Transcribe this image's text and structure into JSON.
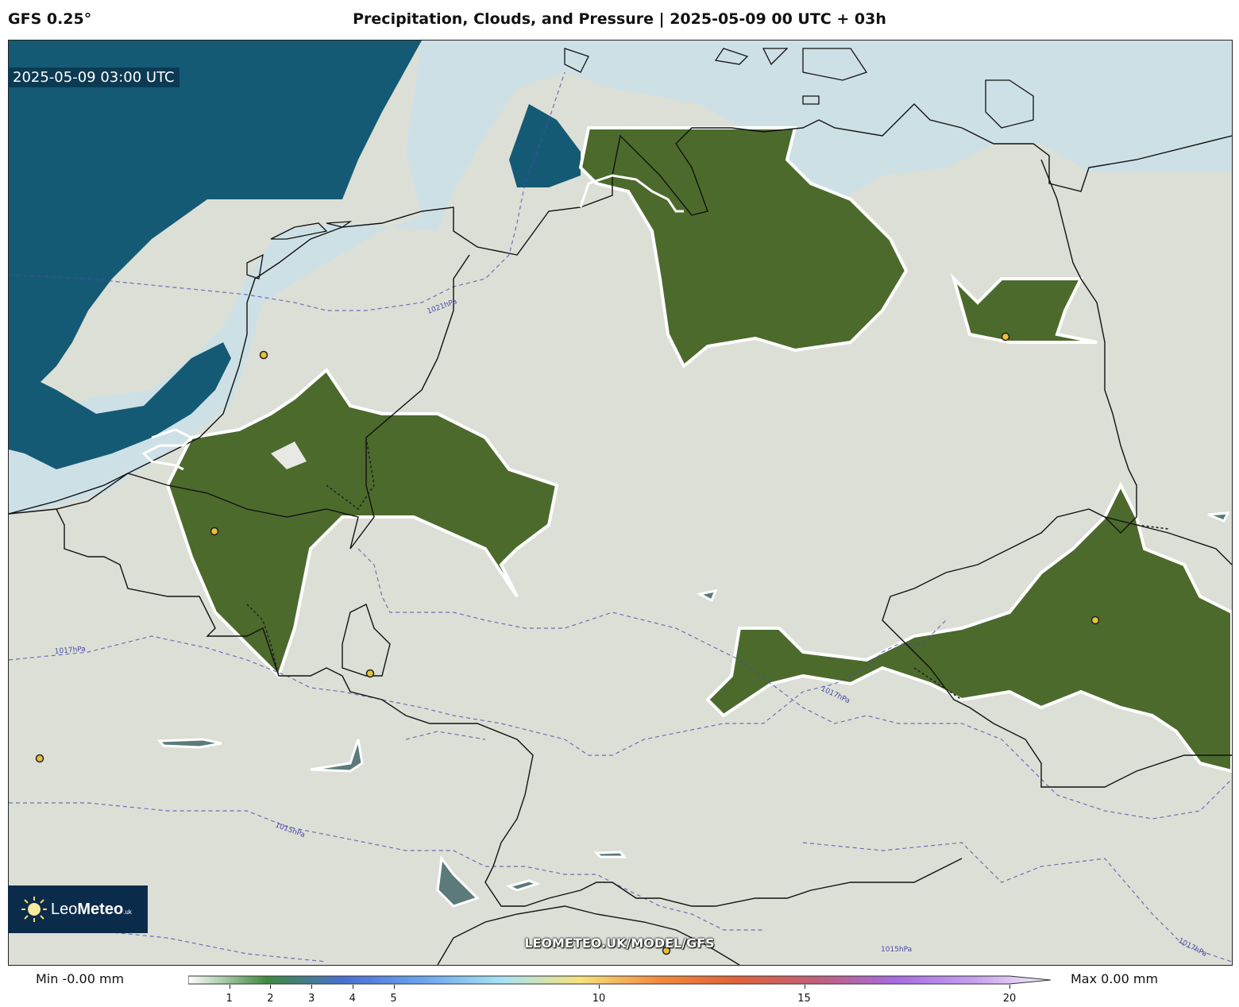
{
  "header": {
    "model": "GFS 0.25°",
    "title": "Precipitation, Clouds, and Pressure | 2025-05-09 00 UTC + 03h"
  },
  "map": {
    "time_label": "2025-05-09 03:00 UTC",
    "isobars": [
      {
        "label": "1021hPa"
      },
      {
        "label": "1017hPa"
      },
      {
        "label": "1015hPa"
      },
      {
        "label": "1015hPa"
      },
      {
        "label": "1017hPa"
      },
      {
        "label": "1017hPa"
      }
    ],
    "colors": {
      "sea": "#155a74",
      "shallow_sea": "#cde0e6",
      "land_cloud": "#dcdfd6",
      "clear_land": "#4c6a2c",
      "isobar": "#4a4aa8",
      "city_marker": "#e6c23a"
    }
  },
  "logo": {
    "brand_light": "Leo",
    "brand_bold": "Meteo",
    "suffix": ".uk",
    "icon": "sun-icon"
  },
  "watermark": "LEOMETEO.UK/MODEL/GFS",
  "colorbar": {
    "min_label": "Min -0.00 mm",
    "max_label": "Max 0.00 mm",
    "range": [
      0,
      20
    ],
    "ticks": [
      "1",
      "2",
      "3",
      "4",
      "5",
      "10",
      "15",
      "20"
    ],
    "tick_values": [
      1,
      2,
      3,
      4,
      5,
      10,
      15,
      20
    ],
    "stops": [
      "#ffffff",
      "#3f8a3f",
      "#4a6fd4",
      "#6aa6ee",
      "#a7e3f5",
      "#f6e27a",
      "#f28a3c",
      "#e0623a",
      "#c0607a",
      "#a86ae0",
      "#c49ef0",
      "#f5eef8"
    ]
  }
}
